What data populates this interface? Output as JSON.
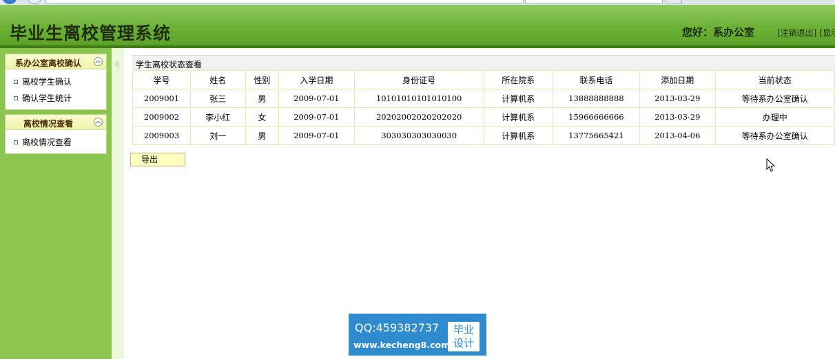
{
  "header": {
    "title": "毕业生离校管理系统",
    "greeting": "您好：系办公室",
    "links": [
      "[注销退出]",
      "[显示"
    ]
  },
  "sidebar": {
    "panels": [
      {
        "title": "系办公室离校确认",
        "items": [
          "离校学生确认",
          "确认学生统计"
        ]
      },
      {
        "title": "离校情况查看",
        "items": [
          "离校情况查看"
        ]
      }
    ]
  },
  "main": {
    "caption": "学生离校状态查看",
    "columns": [
      "学号",
      "姓名",
      "性别",
      "入学日期",
      "身份证号",
      "所在院系",
      "联系电话",
      "添加日期",
      "当前状态"
    ],
    "rows": [
      [
        "2009001",
        "张三",
        "男",
        "2009-07-01",
        "10101010101010100",
        "计算机系",
        "13888888888",
        "2013-03-29",
        "等待系办公室确认"
      ],
      [
        "2009002",
        "李小红",
        "女",
        "2009-07-01",
        "20202002020202020",
        "计算机系",
        "15966666666",
        "2013-03-29",
        "办理中"
      ],
      [
        "2009003",
        "刘一",
        "男",
        "2009-07-01",
        "303030303030030",
        "计算机系",
        "13775665421",
        "2013-04-06",
        "等待系办公室确认"
      ]
    ],
    "export_label": "导出"
  },
  "watermark": {
    "qq": "QQ:459382737",
    "url": "www.kecheng8.com",
    "badge_line1": "毕业",
    "badge_line2": "设计"
  },
  "colors": {
    "header_green": "#6db137",
    "sidebar_green": "#8cc651",
    "panel_title": "#4a2c05",
    "table_border": "#f1e1b5",
    "export_button": "#fdfcbf",
    "watermark_blue": "#2e8bce"
  }
}
